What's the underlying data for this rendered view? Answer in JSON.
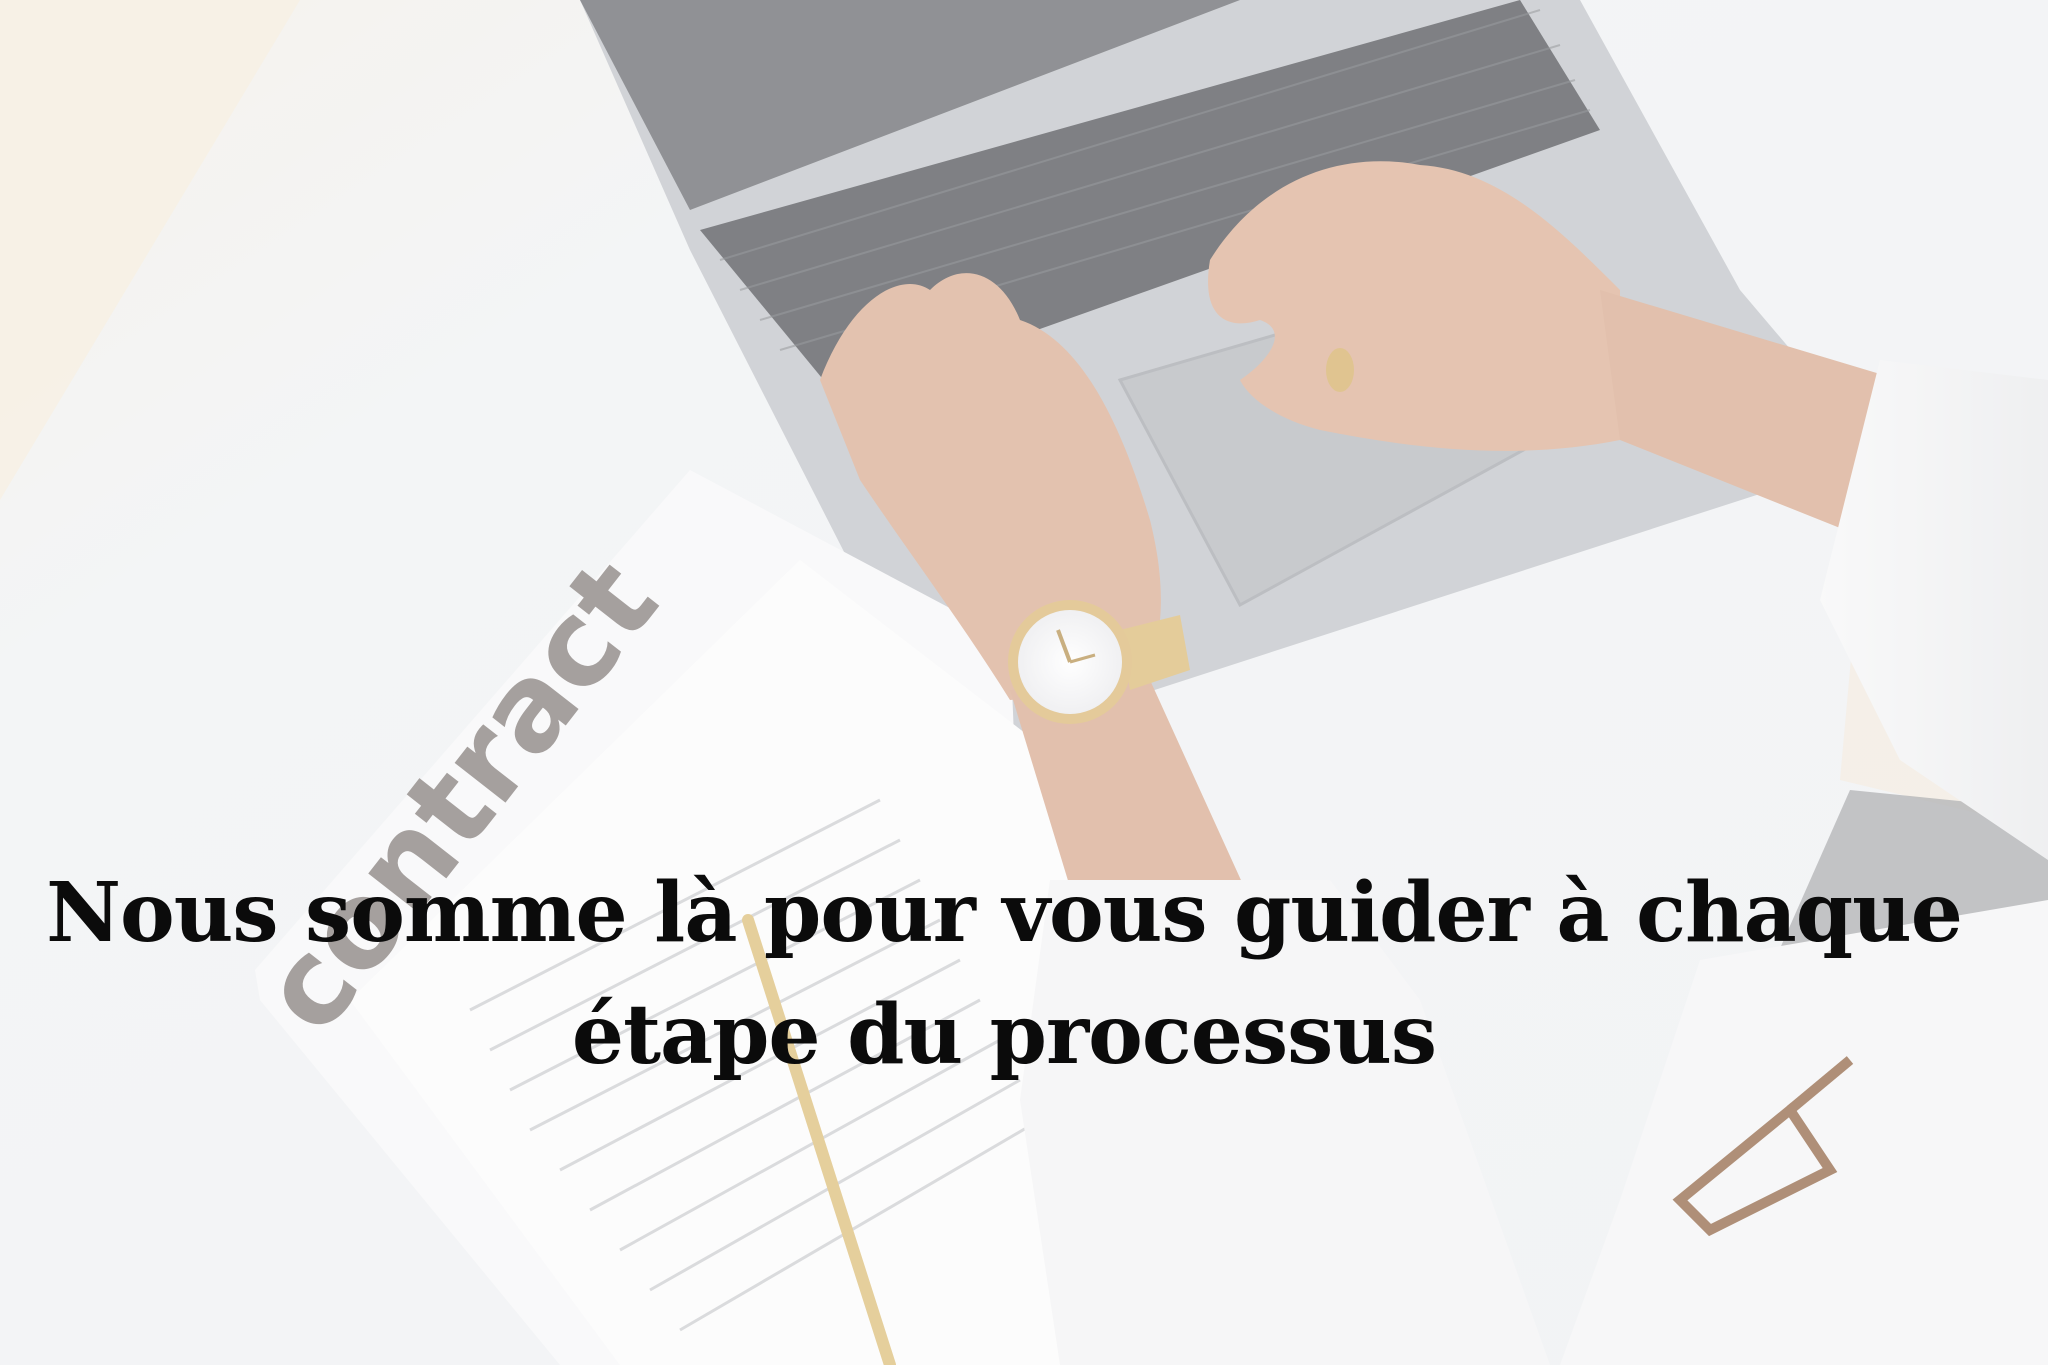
{
  "headline": {
    "line1": "Nous somme là pour vous guider à chaque",
    "line2": "étape du processus"
  },
  "document": {
    "word": "contract"
  },
  "colors": {
    "background": "#eef0f2",
    "laptop_body": "#b9bcc2",
    "keyboard": "#3f4146",
    "skin": "#d9a98c",
    "gold": "#d8b46a",
    "text": "#0b0b0b"
  }
}
